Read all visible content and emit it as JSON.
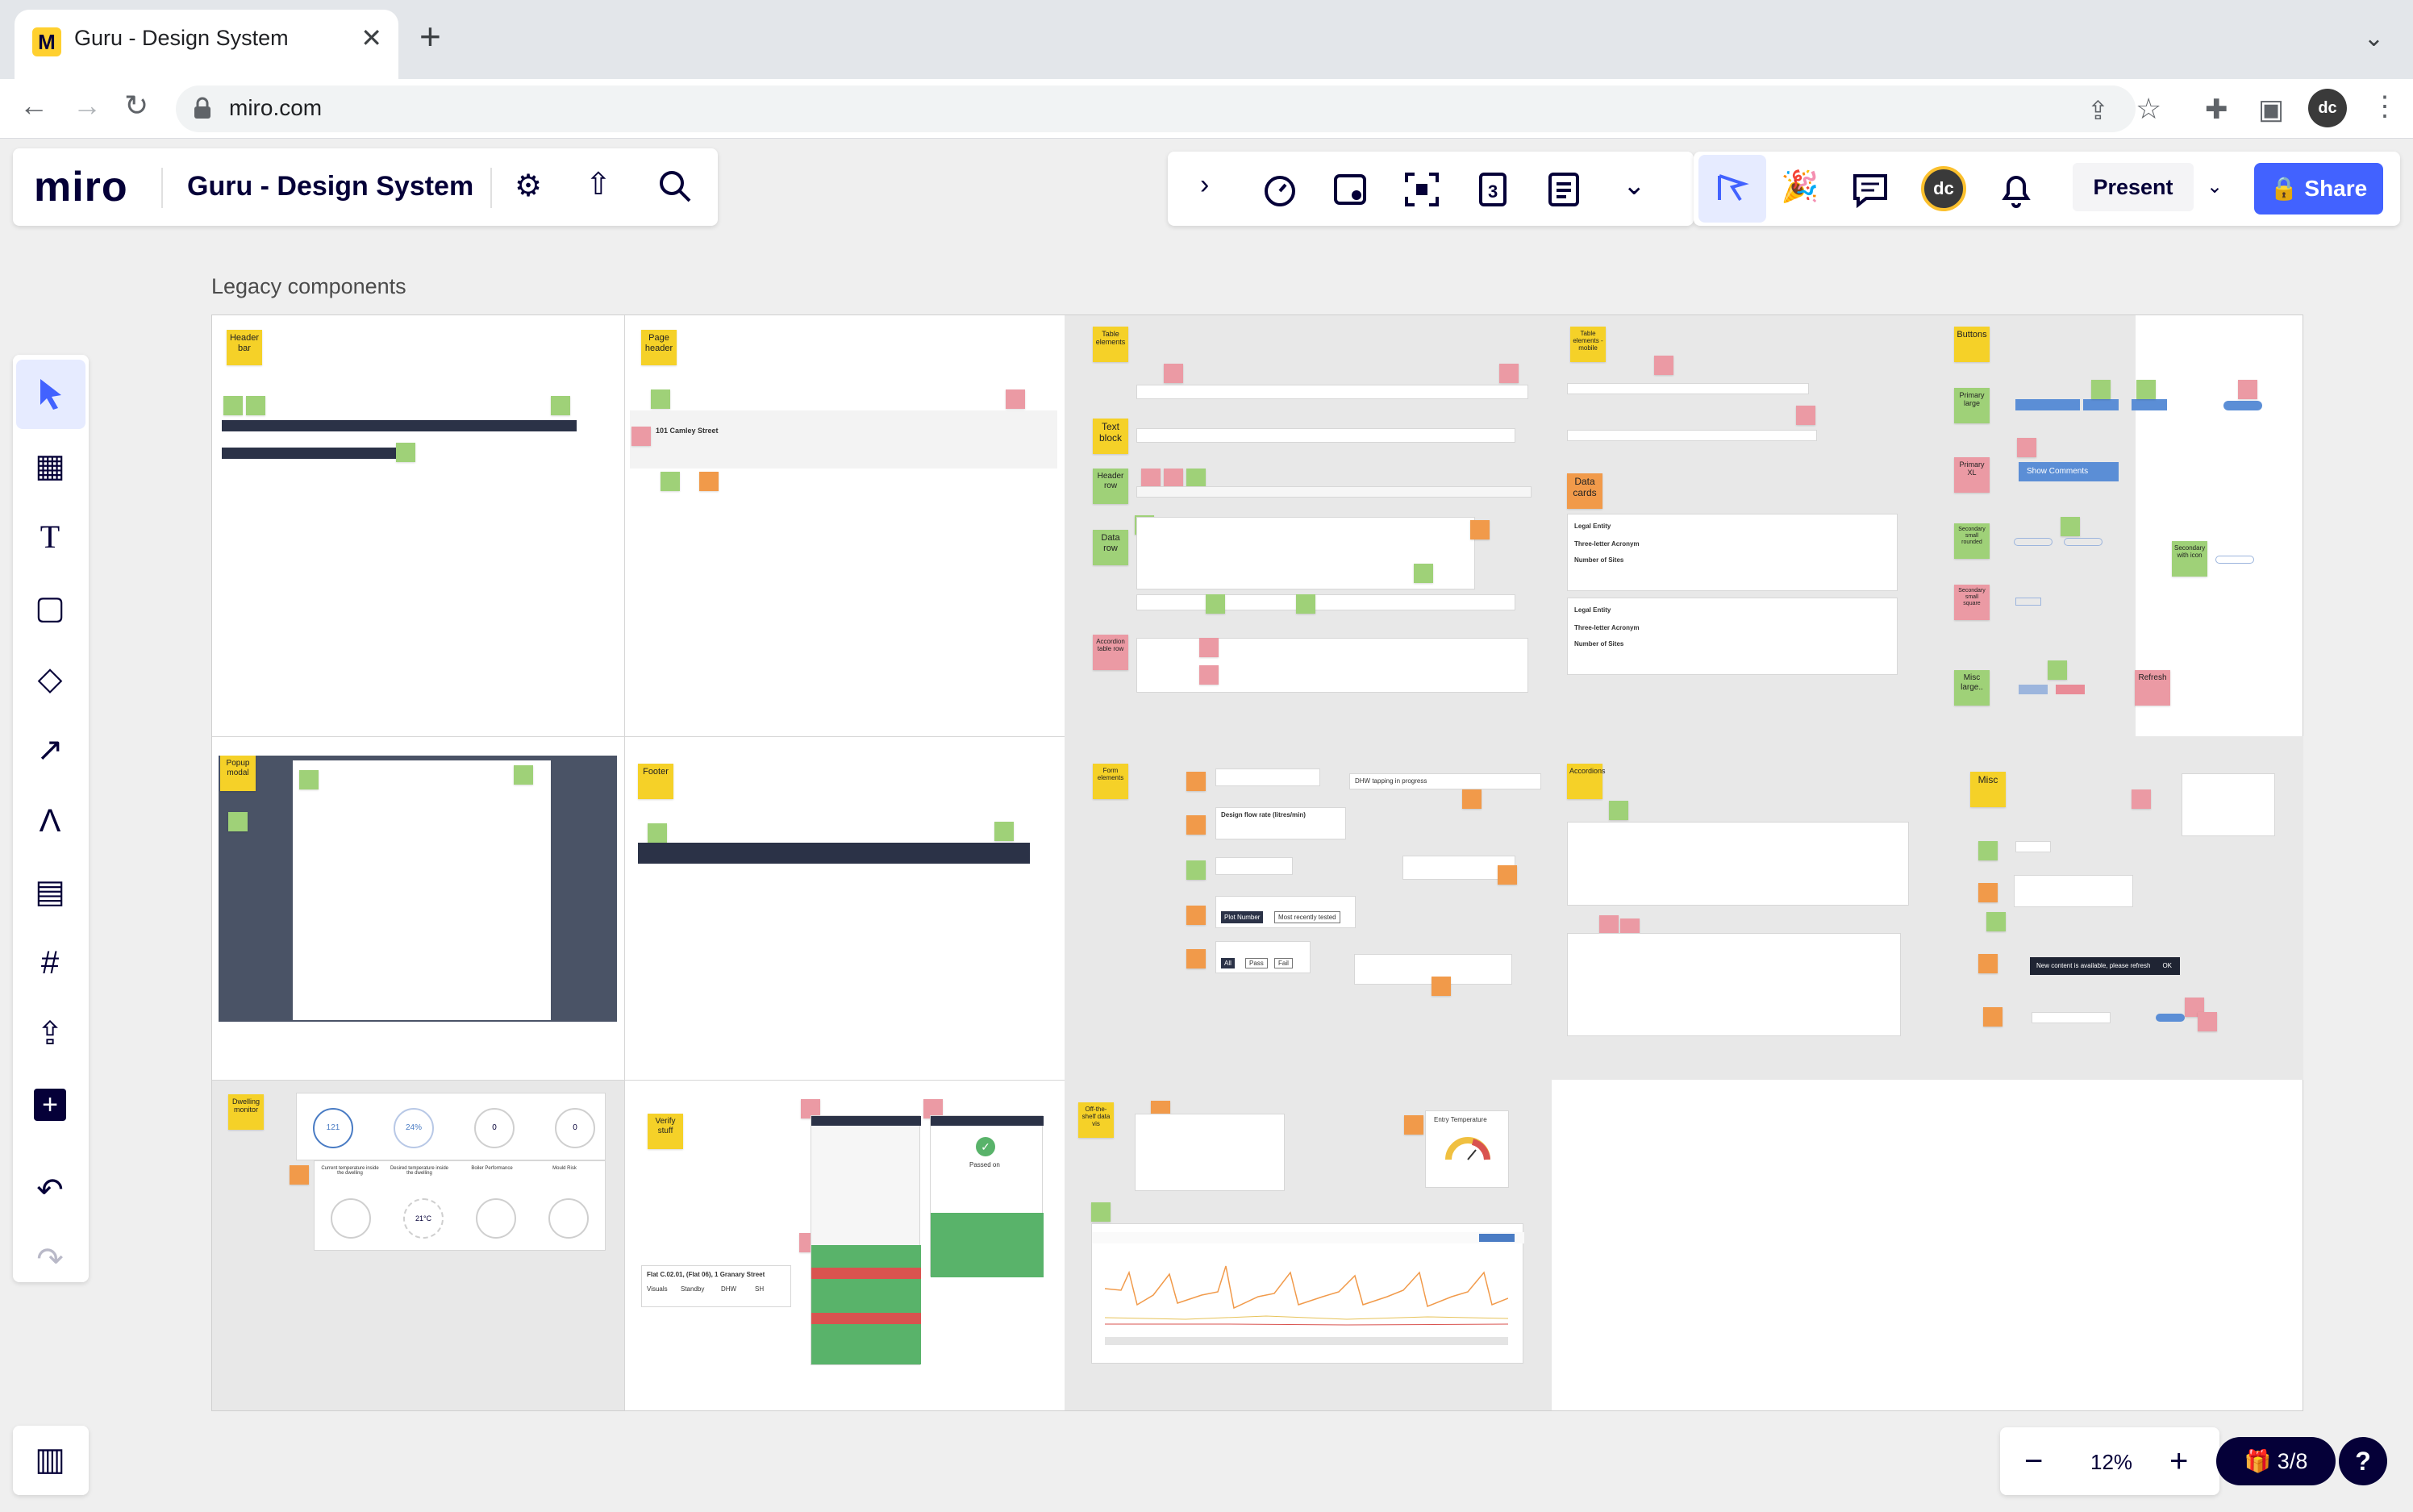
{
  "browser": {
    "tab_title": "Guru - Design System",
    "favicon": "M",
    "url": "miro.com",
    "profile_initials": "dc"
  },
  "board": {
    "logo": "miro",
    "title": "Guru - Design System",
    "present_label": "Present",
    "share_label": "Share",
    "collab_initials": "dc",
    "frame_title": "Legacy components"
  },
  "stickies": {
    "header_bar": "Header bar",
    "page_header": "Page header",
    "table_elements": "Table elements",
    "text_block": "Text block",
    "header_row": "Header row",
    "data_row": "Data row",
    "accordion_table_row": "Accordion table row",
    "table_elements_mobile": "Table elements - mobile",
    "data_cards": "Data cards",
    "buttons": "Buttons",
    "primary_large": "Primary large",
    "primary_xl": "Primary XL",
    "secondary_small_rounded": "Secondary small rounded",
    "secondary_small_square": "Secondary small square",
    "secondary_with_icon": "Secondary with icon",
    "misc_large": "Misc large..",
    "refresh": "Refresh",
    "popup_modal": "Popup modal",
    "footer": "Footer",
    "form_elements": "Form elements",
    "accordions": "Accordions",
    "misc": "Misc",
    "dwelling_monitor": "Dwelling monitor",
    "verify_stuff": "Verify stuff",
    "off_the_shelf": "Off-the-shelf data vis"
  },
  "mock_text": {
    "address": "101 Camley Street",
    "show_comments": "Show Comments",
    "design_flow_rate": "Design flow rate (litres/min)",
    "plot_number": "Plot Number",
    "most_recently_tested": "Most recently tested",
    "all": "All",
    "pass": "Pass",
    "fail": "Fail",
    "dhw_tapping": "DHW tapping in progress",
    "new_content": "New content is available, please refresh",
    "ok": "OK",
    "legal_entity": "Legal Entity",
    "three_letter": "Three-letter Acronym",
    "number_of_sites": "Number of Sites",
    "flat_address": "Flat C.02.01, (Flat 06), 1 Granary Street",
    "visuals": "Visuals",
    "standby": "Standby",
    "dhw": "DHW",
    "sh": "SH",
    "passed": "Passed on",
    "gauge_value_1": "121",
    "gauge_value_2": "24%",
    "gauge_value_3": "0",
    "gauge_value_4": "0",
    "gauge_value_5": "21°C",
    "current_temp": "Current temperature inside the dwelling",
    "desired_temp": "Desired temperature inside the dwelling",
    "boiler_perf": "Boiler Performance",
    "mould_risk": "Mould Risk",
    "entry_temp": "Entry Temperature"
  },
  "zoom": {
    "minus": "−",
    "value": "12%",
    "plus": "+",
    "gift_count": "3/8",
    "help": "?"
  },
  "colors": {
    "brand_blue": "#4262ff",
    "miro_yellow": "#ffd02f",
    "sticky_yellow": "#f5d128",
    "sticky_green": "#9fd178",
    "sticky_pink": "#eb9aa4",
    "sticky_orange": "#f19a4a"
  }
}
